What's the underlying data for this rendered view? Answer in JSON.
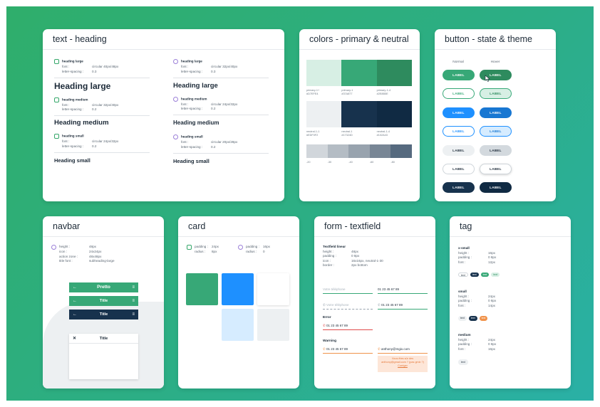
{
  "text_heading": {
    "title": "text - heading",
    "left": [
      {
        "name": "heading large",
        "font_key": "font :",
        "font_val": "circular 40px/48px",
        "ls_key": "letter-spacing :",
        "ls_val": "0.3",
        "sample": "Heading large"
      },
      {
        "name": "heading medium",
        "font_key": "font :",
        "font_val": "circular 32px/40px",
        "ls_key": "letter-spacing :",
        "ls_val": "0.2",
        "sample": "Heading medium"
      },
      {
        "name": "heading small",
        "font_key": "font :",
        "font_val": "circular 24px/32px",
        "ls_key": "letter-spacing :",
        "ls_val": "0.2",
        "sample": "Heading small"
      }
    ],
    "right": [
      {
        "name": "heading large",
        "font_key": "font :",
        "font_val": "circular 32px/40px",
        "ls_key": "letter-spacing :",
        "ls_val": "0.3",
        "sample": "Heading large"
      },
      {
        "name": "heading medium",
        "font_key": "font :",
        "font_val": "circular 24px/32px",
        "ls_key": "letter-spacing :",
        "ls_val": "0.2",
        "sample": "Heading medium"
      },
      {
        "name": "heading small",
        "font_key": "font :",
        "font_val": "circular 20px/28px",
        "ls_key": "letter-spacing :",
        "ls_val": "0.2",
        "sample": "Heading small"
      }
    ]
  },
  "colors": {
    "title": "colors - primary & neutral",
    "primary": [
      {
        "name": "primary-1+",
        "hex": "#D7EFE4",
        "color": "#d7efe4"
      },
      {
        "name": "primary-1",
        "hex": "#37A877",
        "color": "#37a877"
      },
      {
        "name": "primary-1-4",
        "hex": "#2E8B5E",
        "color": "#2e8b5e"
      }
    ],
    "neutral": [
      {
        "name": "neutral-1-1",
        "hex": "#EDF0F2",
        "color": "#edf0f2"
      },
      {
        "name": "neutral-1",
        "hex": "#17324D",
        "color": "#17324d"
      },
      {
        "name": "neutral-1-4",
        "hex": "#102A43",
        "color": "#102a43"
      }
    ],
    "greys": [
      {
        "name": "-20",
        "color": "#d1d6db"
      },
      {
        "name": "-30",
        "color": "#b4bcc4"
      },
      {
        "name": "-40",
        "color": "#98a3ae"
      },
      {
        "name": "-60",
        "color": "#788695"
      },
      {
        "name": "-80",
        "color": "#566a7f"
      }
    ]
  },
  "buttons": {
    "title": "button - state & theme",
    "normal_label": "Normal",
    "hover_label": "Hover",
    "label": "LABEL"
  },
  "navbar": {
    "title": "navbar",
    "specs": [
      {
        "k": "height :",
        "v": "48px"
      },
      {
        "k": "icon :",
        "v": "24x24px"
      },
      {
        "k": "action zone :",
        "v": "48x48px"
      },
      {
        "k": "title font :",
        "v": "subheading-large"
      }
    ],
    "bars": [
      {
        "title": "Pretto",
        "left": "←",
        "right": "≡"
      },
      {
        "title": "Title",
        "left": "←",
        "right": "≡"
      },
      {
        "title": "Title",
        "left": "←",
        "right": "≡"
      },
      {
        "title": "Title",
        "left": "✕",
        "right": ""
      }
    ]
  },
  "card": {
    "title": "card",
    "spec_a": [
      {
        "k": "padding :",
        "v": "24px"
      },
      {
        "k": "radius :",
        "v": "8px"
      }
    ],
    "spec_b": [
      {
        "k": "padding :",
        "v": "16px"
      },
      {
        "k": "radius :",
        "v": "0"
      }
    ]
  },
  "form": {
    "title": "form - textfield",
    "spec_title": "Textfield linear",
    "specs": [
      {
        "k": "height :",
        "v": "48px"
      },
      {
        "k": "padding :",
        "v": "0 8px"
      },
      {
        "k": "icon :",
        "v": "16x16px, neutral-1-30"
      },
      {
        "k": "border :",
        "v": "2px bottom"
      }
    ],
    "placeholder": "Votre téléphone",
    "phone": "01 23 45 67 89",
    "error_label": "Error",
    "warning_label": "Warning",
    "email": "anthony@mgix.com",
    "hint": "Vous êtes sûr des anthony@gmail.com ? (pas gmix ?)",
    "hint_action": "Corriger"
  },
  "tag": {
    "title": "tag",
    "groups": [
      {
        "name": "x-small",
        "specs": [
          {
            "k": "height :",
            "v": "16px"
          },
          {
            "k": "padding :",
            "v": "0 8px"
          },
          {
            "k": "font :",
            "v": "12px"
          }
        ]
      },
      {
        "name": "small",
        "specs": [
          {
            "k": "height :",
            "v": "24px"
          },
          {
            "k": "padding :",
            "v": "0 8px"
          },
          {
            "k": "font :",
            "v": "14px"
          }
        ]
      },
      {
        "name": "medium",
        "specs": [
          {
            "k": "height :",
            "v": "24px"
          },
          {
            "k": "padding :",
            "v": "0 8px"
          },
          {
            "k": "font :",
            "v": "16px"
          }
        ]
      }
    ],
    "pill_text": "text"
  }
}
